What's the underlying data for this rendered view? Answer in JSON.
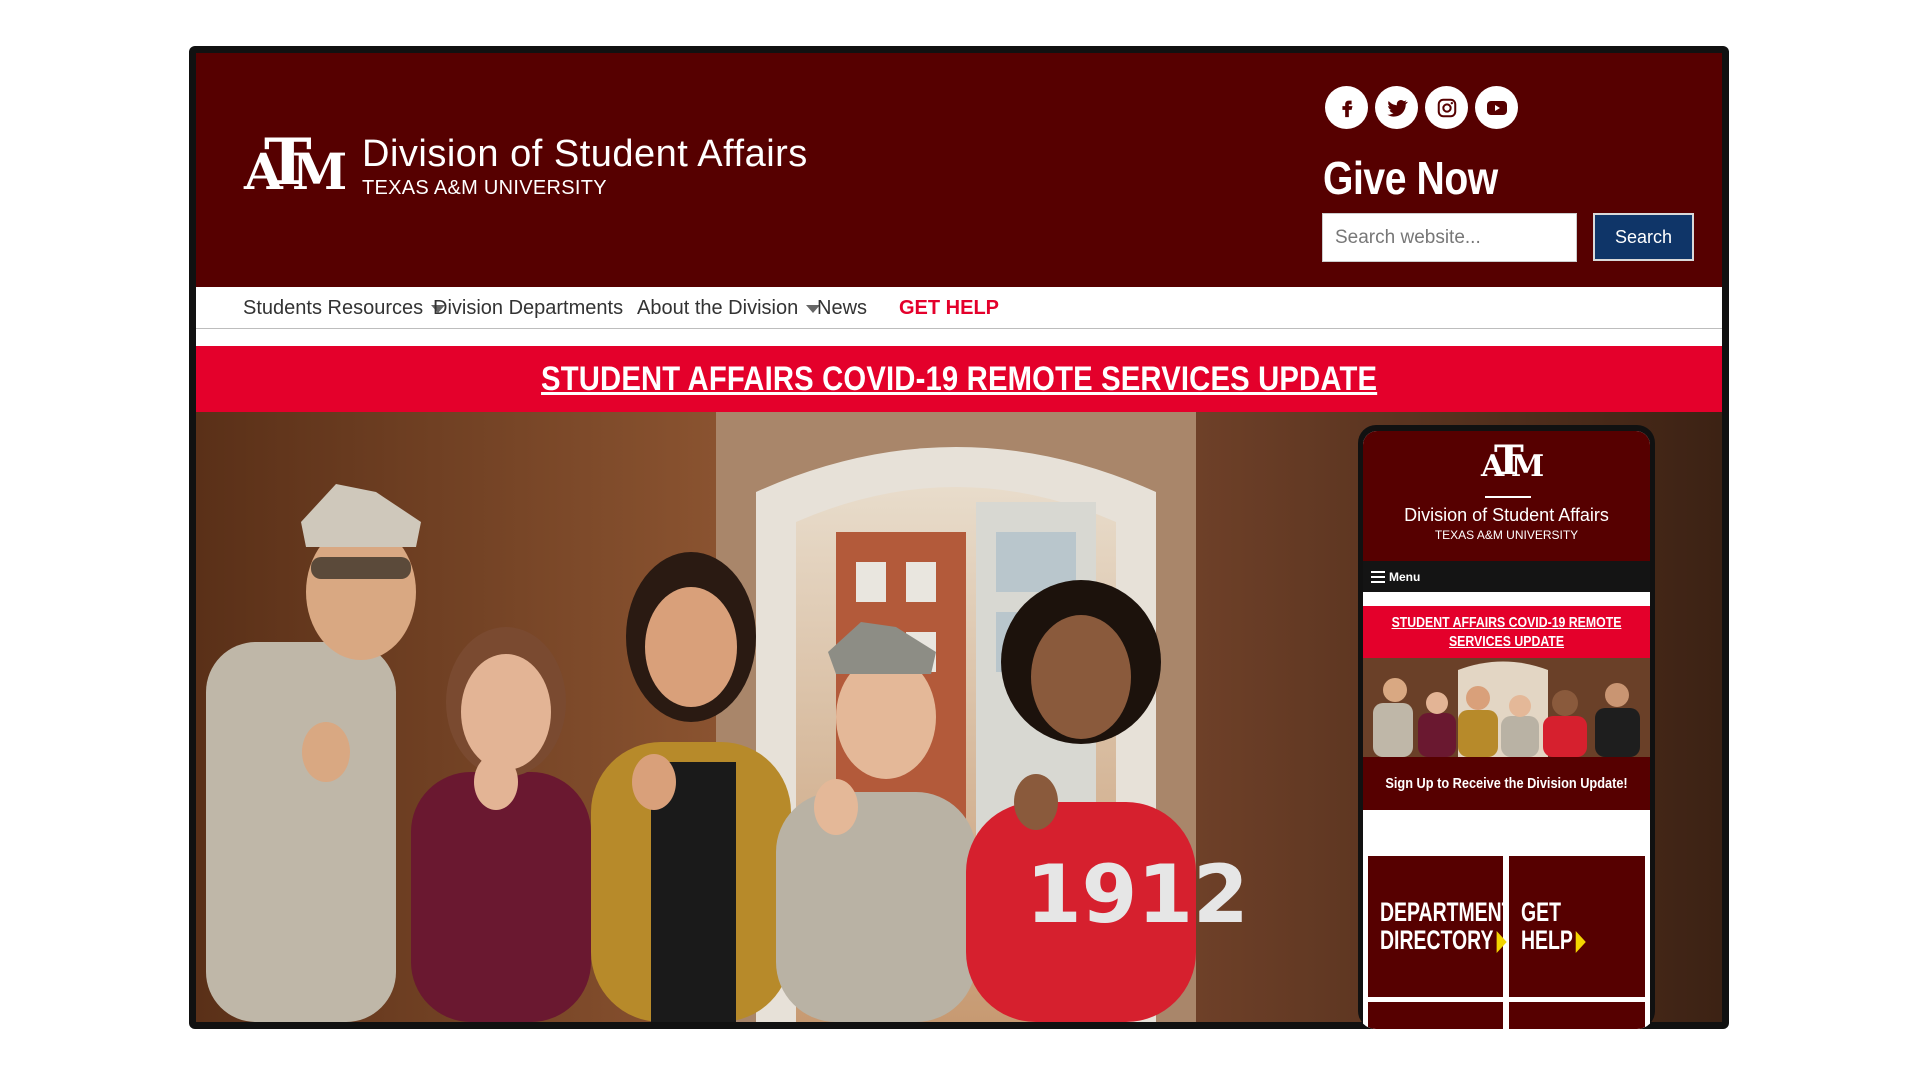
{
  "header": {
    "logo_icon": "atm-logo",
    "title": "Division of Student Affairs",
    "subtitle": "TEXAS A&M UNIVERSITY",
    "social": [
      {
        "icon": "facebook-icon"
      },
      {
        "icon": "twitter-icon"
      },
      {
        "icon": "instagram-icon"
      },
      {
        "icon": "youtube-icon"
      }
    ],
    "give_now": "Give Now",
    "search": {
      "placeholder": "Search website...",
      "button": "Search"
    }
  },
  "nav": {
    "items": [
      {
        "label": "Students Resources",
        "dropdown": true
      },
      {
        "label": "Division Departments",
        "dropdown": false
      },
      {
        "label": "About the Division",
        "dropdown": true
      },
      {
        "label": "News",
        "dropdown": false
      },
      {
        "label": "GET HELP",
        "dropdown": false
      }
    ]
  },
  "banner": {
    "text": "STUDENT AFFAIRS COVID-19 REMOTE SERVICES UPDATE"
  },
  "hero": {
    "jersey_text": "1912"
  },
  "mobile": {
    "title": "Division of Student Affairs",
    "subtitle": "TEXAS A&M UNIVERSITY",
    "menu_label": "Menu",
    "covid_text": "STUDENT AFFAIRS COVID-19 REMOTE SERVICES UPDATE",
    "signup_text": "Sign Up to Receive the Division Update!",
    "tiles": [
      {
        "line1": "DEPARTMENT",
        "line2": "DIRECTORY"
      },
      {
        "line1": "GET",
        "line2": "HELP"
      }
    ]
  },
  "colors": {
    "maroon": "#560000",
    "red": "#e4002b",
    "navy": "#0f3568",
    "yellow": "#f3d500"
  }
}
